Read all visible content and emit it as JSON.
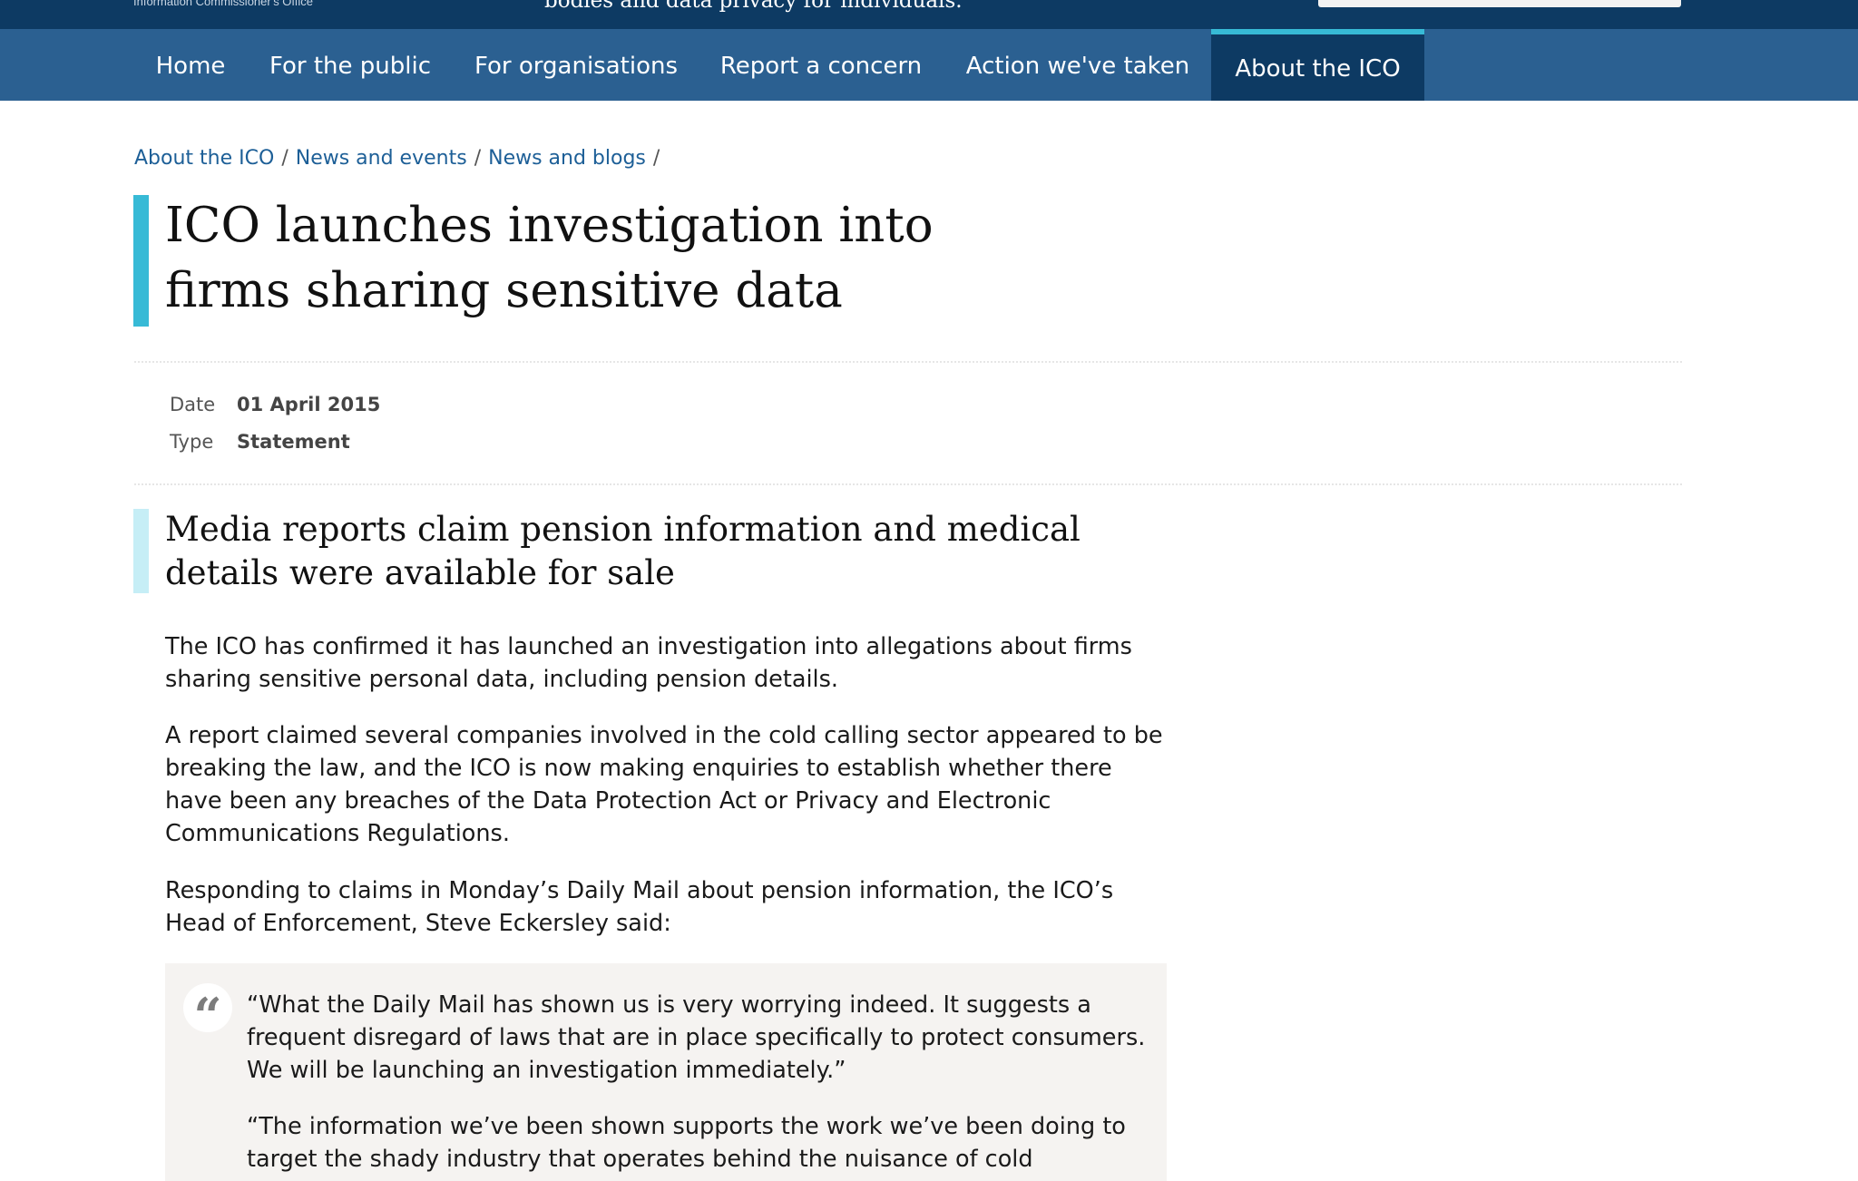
{
  "header": {
    "org_name": "Information Commissioner's Office",
    "tagline": "bodies and data privacy for individuals."
  },
  "nav": {
    "items": [
      {
        "label": "Home"
      },
      {
        "label": "For the public"
      },
      {
        "label": "For organisations"
      },
      {
        "label": "Report a concern"
      },
      {
        "label": "Action we've taken"
      },
      {
        "label": "About the ICO",
        "active": true
      }
    ]
  },
  "breadcrumb": {
    "items": [
      "About the ICO",
      "News and events",
      "News and blogs"
    ],
    "separator": "/"
  },
  "article": {
    "title": "ICO launches investigation into firms sharing sensitive data",
    "meta": {
      "date_label": "Date",
      "date_value": "01 April 2015",
      "type_label": "Type",
      "type_value": "Statement"
    },
    "subtitle": "Media reports claim pension information and medical details were available for sale",
    "paragraphs": [
      "The ICO has confirmed it has launched an investigation into allegations about firms sharing sensitive personal data, including pension details.",
      "A report claimed several companies involved in the cold calling sector appeared to be breaking the law, and the ICO is now making enquiries to establish whether there have been any breaches of the Data Protection Act or Privacy and Electronic Communications Regulations.",
      "Responding to claims in Monday’s Daily Mail about pension information, the ICO’s Head of Enforcement, Steve Eckersley said:"
    ],
    "quote": {
      "mark": "“",
      "paragraphs": [
        "“What the Daily Mail has shown us is very worrying indeed. It suggests a frequent disregard of laws that are in place specifically to protect consumers. We will be launching an investigation immediately.”",
        "“The information we’ve been shown supports the work we’ve been doing to target the shady industry that operates behind the nuisance of cold"
      ]
    }
  },
  "colors": {
    "header_bg": "#0d3a63",
    "nav_bg": "#2b6091",
    "accent": "#37bad6",
    "accent_light": "#c6eef6",
    "link": "#1d5f97",
    "quote_bg": "#f5f3f1"
  }
}
